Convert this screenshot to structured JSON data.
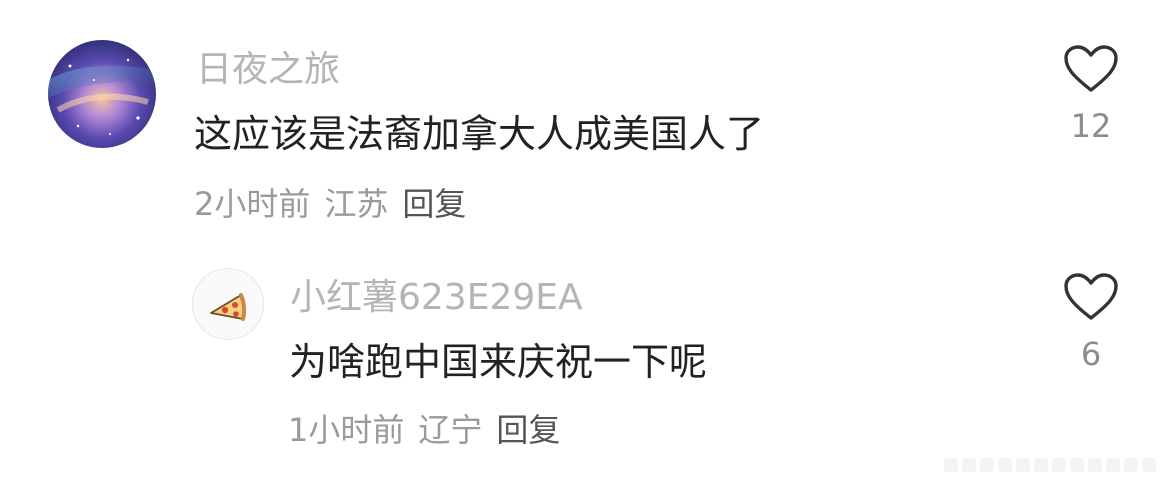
{
  "comments": [
    {
      "username": "日夜之旅",
      "text": "这应该是法裔加拿大人成美国人了",
      "time": "2小时前",
      "location": "江苏",
      "reply_label": "回复",
      "likes": "12"
    },
    {
      "username": "小红薯623E29EA",
      "text": "为啥跑中国来庆祝一下呢",
      "time": "1小时前",
      "location": "辽宁",
      "reply_label": "回复",
      "likes": "6"
    }
  ],
  "icons": {
    "like": "heart-outline-icon",
    "reply_avatar": "pizza-icon"
  },
  "colors": {
    "username": "#b4b4b4",
    "text": "#222222",
    "meta": "#9a9a9a"
  }
}
